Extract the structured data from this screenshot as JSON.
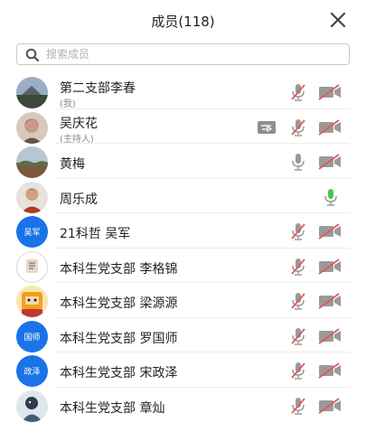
{
  "header": {
    "title": "成员(118)"
  },
  "search": {
    "placeholder": "搜索成员",
    "value": ""
  },
  "colors": {
    "accent": "#1a73e8",
    "muted_red": "#e05a5a",
    "active_green": "#4cc24c",
    "icon_gray": "#9a9a9a"
  },
  "members": [
    {
      "name": "第二支部李春",
      "sub": "(我)",
      "avatar": "photo",
      "mic": "muted",
      "cam": "off",
      "share": false
    },
    {
      "name": "吴庆花",
      "sub": "(主持人)",
      "avatar": "photo",
      "mic": "muted",
      "cam": "off",
      "share": true
    },
    {
      "name": "黄梅",
      "sub": "",
      "avatar": "photo",
      "mic": "on",
      "cam": "off",
      "share": false
    },
    {
      "name": "周乐成",
      "sub": "",
      "avatar": "photo",
      "mic": "speaking",
      "cam": "none",
      "share": false
    },
    {
      "name": "21科哲  吴军",
      "sub": "",
      "avatar": "吴军",
      "mic": "muted",
      "cam": "off",
      "share": false
    },
    {
      "name": "本科生党支部 李格锦",
      "sub": "",
      "avatar": "photo",
      "mic": "muted",
      "cam": "off",
      "share": false
    },
    {
      "name": "本科生党支部 梁源源",
      "sub": "",
      "avatar": "photo",
      "mic": "muted",
      "cam": "off",
      "share": false
    },
    {
      "name": "本科生党支部 罗国师",
      "sub": "",
      "avatar": "国师",
      "mic": "muted",
      "cam": "off",
      "share": false
    },
    {
      "name": "本科生党支部 宋政泽",
      "sub": "",
      "avatar": "政泽",
      "mic": "muted",
      "cam": "off",
      "share": false
    },
    {
      "name": "本科生党支部 章灿",
      "sub": "",
      "avatar": "photo",
      "mic": "muted",
      "cam": "off",
      "share": false
    }
  ]
}
